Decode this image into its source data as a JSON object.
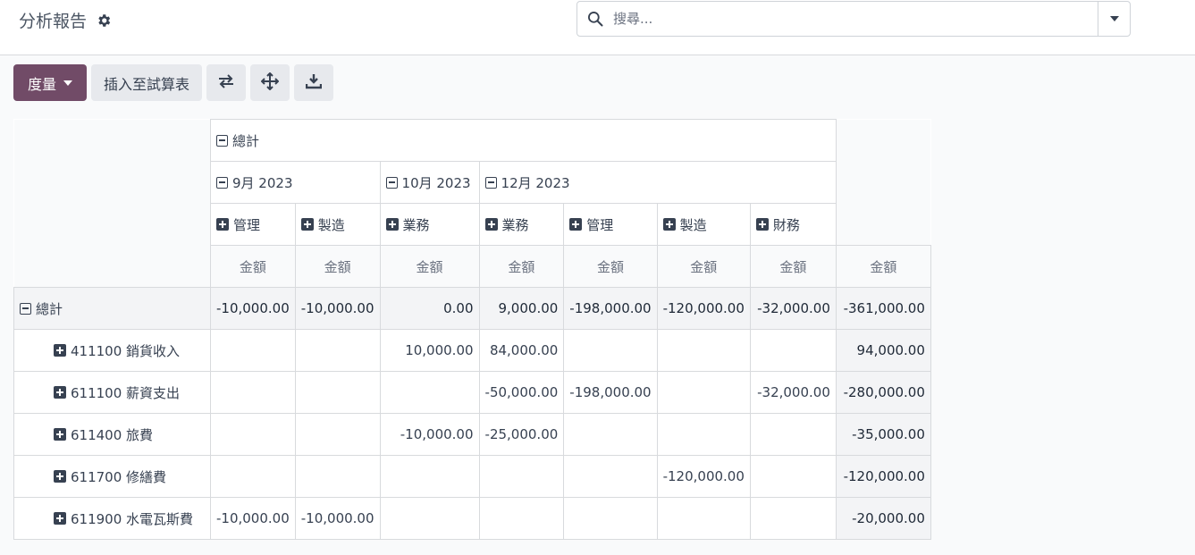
{
  "header": {
    "title": "分析報告",
    "search_placeholder": "搜尋..."
  },
  "toolbar": {
    "measures_label": "度量",
    "insert_label": "插入至試算表",
    "icons": [
      "swap-icon",
      "expand-arrows-icon",
      "download-icon"
    ]
  },
  "pivot": {
    "total_label": "總計",
    "months": [
      "9月 2023",
      "10月 2023",
      "12月 2023"
    ],
    "departments": [
      "管理",
      "製造",
      "業務",
      "業務",
      "管理",
      "製造",
      "財務"
    ],
    "measure_label": "金額",
    "total_row": [
      "-10,000.00",
      "-10,000.00",
      "0.00",
      "9,000.00",
      "-198,000.00",
      "-120,000.00",
      "-32,000.00",
      "-361,000.00"
    ],
    "rows": [
      {
        "label": "411100 銷貨收入",
        "cells": [
          "",
          "",
          "10,000.00",
          "84,000.00",
          "",
          "",
          "",
          "94,000.00"
        ]
      },
      {
        "label": "611100 薪資支出",
        "cells": [
          "",
          "",
          "",
          "-50,000.00",
          "-198,000.00",
          "",
          "-32,000.00",
          "-280,000.00"
        ]
      },
      {
        "label": "611400 旅費",
        "cells": [
          "",
          "",
          "-10,000.00",
          "-25,000.00",
          "",
          "",
          "",
          "-35,000.00"
        ]
      },
      {
        "label": "611700 修繕費",
        "cells": [
          "",
          "",
          "",
          "",
          "",
          "-120,000.00",
          "",
          "-120,000.00"
        ]
      },
      {
        "label": "611900 水電瓦斯費",
        "cells": [
          "-10,000.00",
          "-10,000.00",
          "",
          "",
          "",
          "",
          "",
          "-20,000.00"
        ]
      }
    ]
  },
  "colors": {
    "primary": "#714b67",
    "secondary_button": "#e7e9ed"
  }
}
